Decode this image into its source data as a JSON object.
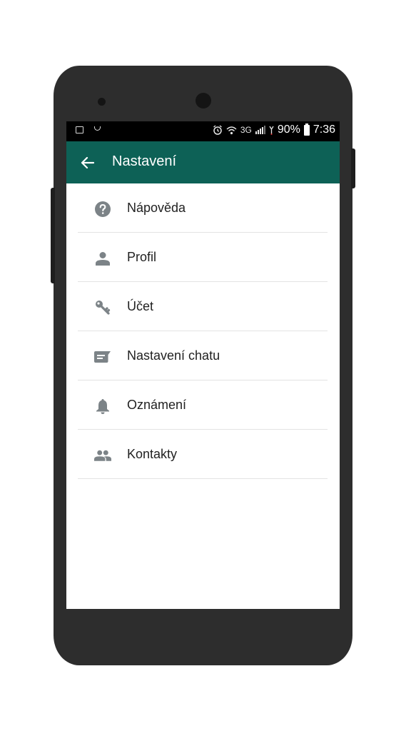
{
  "status_bar": {
    "network": "3G",
    "battery": "90%",
    "time": "7:36"
  },
  "app_bar": {
    "title": "Nastavení",
    "color": "#0d6156"
  },
  "menu": {
    "items": [
      {
        "label": "Nápověda",
        "icon": "help-circle-icon"
      },
      {
        "label": "Profil",
        "icon": "person-icon"
      },
      {
        "label": "Účet",
        "icon": "key-icon"
      },
      {
        "label": "Nastavení chatu",
        "icon": "chat-icon"
      },
      {
        "label": "Oznámení",
        "icon": "bell-icon"
      },
      {
        "label": "Kontakty",
        "icon": "group-icon"
      }
    ]
  }
}
